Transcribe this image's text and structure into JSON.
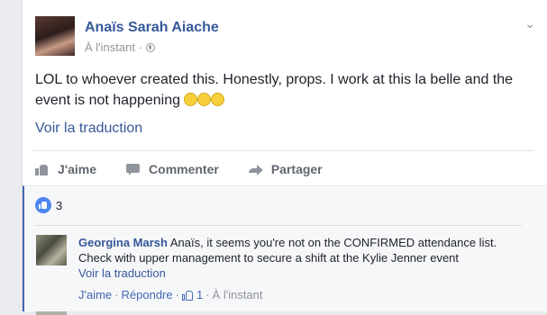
{
  "post": {
    "author": "Anaïs Sarah Aiache",
    "timestamp": "À l'instant",
    "privacy_icon": "globe-icon",
    "options_icon": "chevron-down-icon",
    "text": "LOL to whoever created this. Honestly, props. I work at this la belle and the event is not happening",
    "emoji_count": 3,
    "translate_label": "Voir la traduction"
  },
  "actions": {
    "like_label": "J'aime",
    "comment_label": "Commenter",
    "share_label": "Partager"
  },
  "reactions": {
    "count": "3",
    "color": "#4e86f0"
  },
  "comment": {
    "author": "Georgina Marsh",
    "text": "Anaïs, it seems you're not on the CONFIRMED attendance list. Check with upper management to secure a shift at the Kylie Jenner event",
    "translate_label": "Voir la traduction",
    "like_label": "J'aime",
    "separator": "·",
    "reply_label": "Répondre",
    "like_count": "1",
    "timestamp": "À l'instant"
  },
  "colors": {
    "link": "#365899",
    "accent": "#4267b2",
    "muted": "#90949c"
  }
}
